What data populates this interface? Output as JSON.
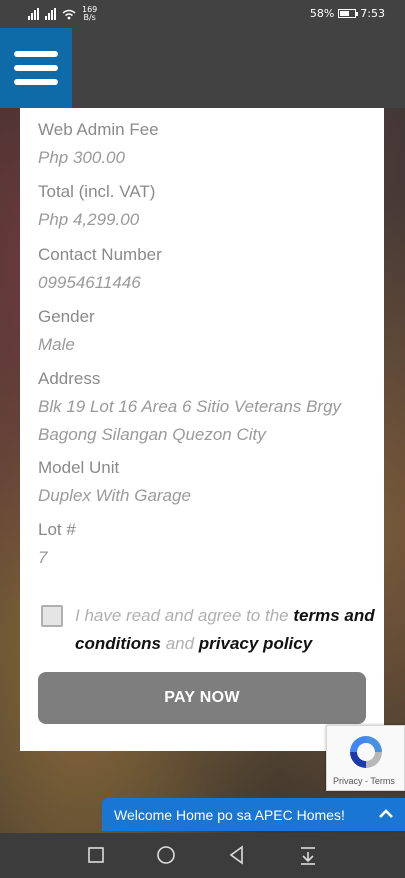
{
  "status_bar": {
    "network_speed": "169",
    "speed_unit": "B/s",
    "battery": "58%",
    "time": "7:53"
  },
  "form": {
    "fields": [
      {
        "label": "Web Admin Fee",
        "value": "Php 300.00"
      },
      {
        "label": "Total (incl. VAT)",
        "value": "Php 4,299.00"
      },
      {
        "label": "Contact Number",
        "value": "09954611446"
      },
      {
        "label": "Gender",
        "value": "Male"
      },
      {
        "label": "Address",
        "value": "Blk 19 Lot 16 Area 6 Sitio Veterans Brgy Bagong Silangan Quezon City"
      },
      {
        "label": "Model Unit",
        "value": "Duplex With Garage"
      },
      {
        "label": "Lot #",
        "value": "7"
      }
    ],
    "agree_prefix": "I have read and agree to the",
    "terms_link": "terms and conditions",
    "agree_and": "and",
    "privacy_link": "privacy policy",
    "pay_button": "PAY NOW"
  },
  "recaptcha": {
    "privacy": "Privacy",
    "separator": "-",
    "terms": "Terms"
  },
  "chat": {
    "label": "Welcome Home po sa APEC Homes!"
  },
  "colors": {
    "menu_bg": "#0f6aa8",
    "chat_bg": "#1976d2",
    "pay_button_bg": "#7e7e7e",
    "header_bg": "#424242"
  },
  "icons": [
    "signal-icon",
    "wifi-icon",
    "battery-icon",
    "hamburger-menu-icon",
    "recaptcha-icon",
    "chevron-up-icon",
    "square-nav-icon",
    "circle-nav-icon",
    "back-triangle-icon",
    "download-nav-icon"
  ]
}
